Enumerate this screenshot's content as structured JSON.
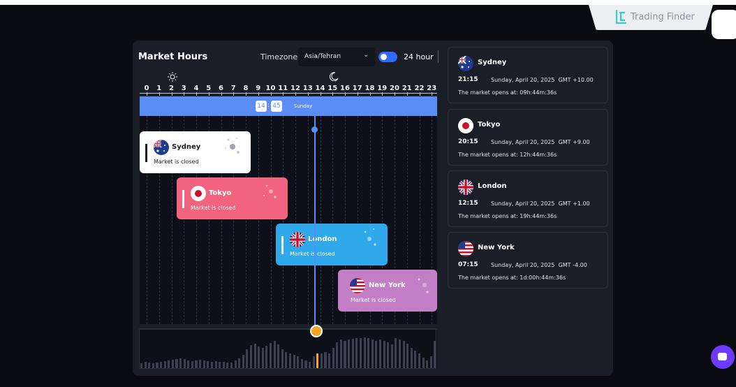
{
  "brand": {
    "name": "Trading Finder"
  },
  "header": {
    "title": "Market Hours",
    "timezone_label": "Timezone:",
    "timezone_value": "Asia/Tehran",
    "format_label": "24 hour",
    "format_24h_enabled": true
  },
  "timeline": {
    "hours": [
      "0",
      "1",
      "2",
      "3",
      "4",
      "5",
      "6",
      "7",
      "8",
      "9",
      "10",
      "11",
      "12",
      "13",
      "14",
      "15",
      "16",
      "17",
      "18",
      "19",
      "20",
      "21",
      "22",
      "23"
    ],
    "current_hour": "14",
    "current_minute": "45",
    "current_day": "Sunday",
    "day_icon": "sun-icon",
    "night_icon": "moon-icon"
  },
  "sessions": [
    {
      "name": "Sydney",
      "status": "Market is closed",
      "color": "#ffffff",
      "text_color": "#1a1e27",
      "flag": "australia-flag-icon"
    },
    {
      "name": "Tokyo",
      "status": "Market is closed",
      "color": "#f2637f",
      "text_color": "#ffffff",
      "flag": "japan-flag-icon"
    },
    {
      "name": "London",
      "status": "Market is closed",
      "color": "#2fa8ec",
      "text_color": "#ffffff",
      "flag": "uk-flag-icon"
    },
    {
      "name": "New York",
      "status": "Market is closed",
      "color": "#c37fc6",
      "text_color": "#ffffff",
      "flag": "usa-flag-icon"
    }
  ],
  "cards": [
    {
      "name": "Sydney",
      "time": "21:15",
      "date": "Sunday, April 20, 2025",
      "gmt": "GMT +10.00",
      "opens": "The market opens at: 09h:44m:36s"
    },
    {
      "name": "Tokyo",
      "time": "20:15",
      "date": "Sunday, April 20, 2025",
      "gmt": "GMT +9.00",
      "opens": "The market opens at: 12h:44m:36s"
    },
    {
      "name": "London",
      "time": "12:15",
      "date": "Sunday, April 20, 2025",
      "gmt": "GMT +1.00",
      "opens": "The market opens at: 19h:44m:36s"
    },
    {
      "name": "New York",
      "time": "07:15",
      "date": "Sunday, April 20, 2025",
      "gmt": "GMT -4.00",
      "opens": "The market opens at: 1d:00h:44m:36s"
    }
  ],
  "colors": {
    "accent": "#5b8df5",
    "now_marker": "#f5a623",
    "chat": "#6b3cff"
  }
}
